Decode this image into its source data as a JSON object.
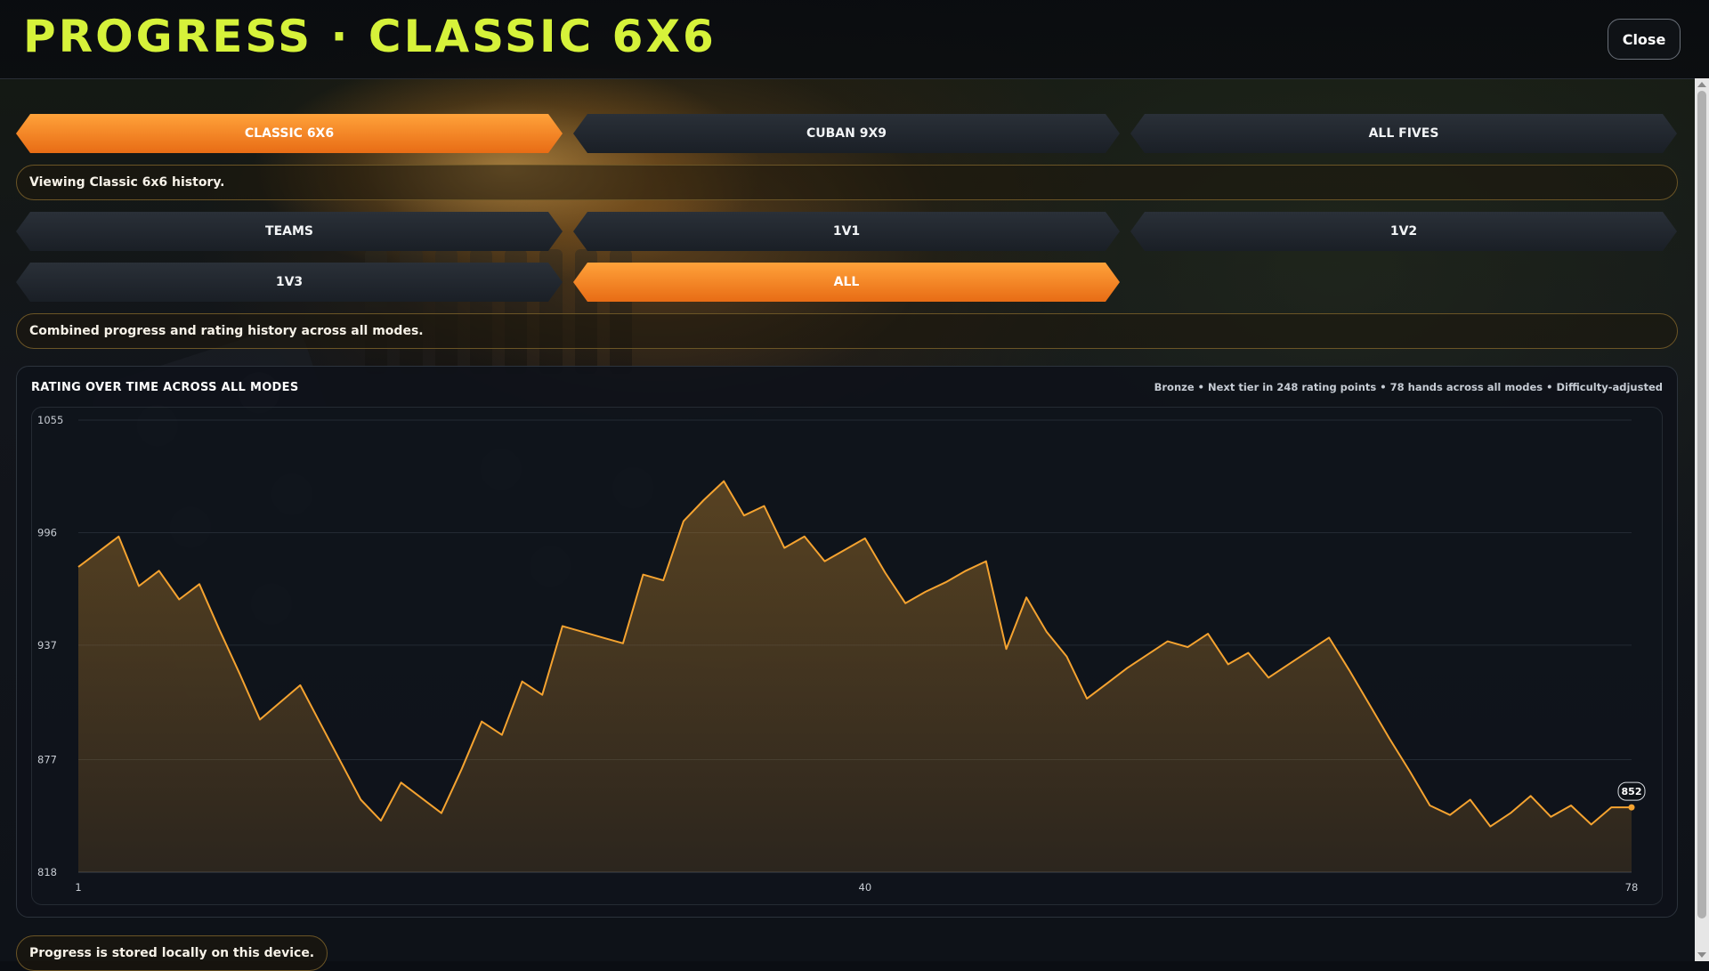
{
  "header": {
    "title": "PROGRESS · CLASSIC 6X6",
    "close_label": "Close"
  },
  "game_tabs": [
    {
      "label": "CLASSIC 6X6",
      "active": true
    },
    {
      "label": "CUBAN 9X9",
      "active": false
    },
    {
      "label": "ALL FIVES",
      "active": false
    }
  ],
  "game_info": "Viewing Classic 6x6 history.",
  "mode_tabs": [
    {
      "label": "TEAMS",
      "active": false
    },
    {
      "label": "1V1",
      "active": false
    },
    {
      "label": "1V2",
      "active": false
    },
    {
      "label": "1V3",
      "active": false
    },
    {
      "label": "ALL",
      "active": true
    }
  ],
  "mode_info": "Combined progress and rating history across all modes.",
  "chart_panel": {
    "title": "RATING OVER TIME ACROSS ALL MODES",
    "meta": "Bronze • Next tier in 248 rating points • 78 hands across all modes • Difficulty-adjusted"
  },
  "footer_note": "Progress is stored locally on this device.",
  "colors": {
    "title": "#d6f23a",
    "accent": "#f59a2e",
    "line": "#f5a330"
  },
  "chart_data": {
    "type": "area",
    "title": "RATING OVER TIME ACROSS ALL MODES",
    "xlabel": "",
    "ylabel": "",
    "x_ticks": [
      1,
      40,
      78
    ],
    "y_ticks": [
      818,
      877,
      937,
      996,
      1055
    ],
    "xlim": [
      1,
      78
    ],
    "ylim": [
      818,
      1055
    ],
    "grid": true,
    "last_value_label": "852",
    "series": [
      {
        "x": [
          1,
          2,
          3,
          4,
          5,
          6,
          7,
          8,
          9,
          10,
          11,
          12,
          13,
          14,
          15,
          16,
          17,
          18,
          19,
          20,
          21,
          22,
          23,
          24,
          25,
          26,
          27,
          28,
          29,
          30,
          31,
          32,
          33,
          34,
          35,
          36,
          37,
          38,
          39,
          40,
          41,
          42,
          43,
          44,
          45,
          46,
          47,
          48,
          49,
          50,
          51,
          52,
          53,
          54,
          55,
          56,
          57,
          58,
          59,
          60,
          61,
          62,
          63,
          64,
          65,
          66,
          67,
          68,
          69,
          70,
          71,
          72,
          73,
          74,
          75,
          76,
          77,
          78
        ],
        "values": [
          978,
          986,
          994,
          968,
          976,
          961,
          969,
          945,
          922,
          898,
          907,
          916,
          896,
          876,
          856,
          845,
          865,
          857,
          849,
          872,
          897,
          890,
          918,
          911,
          947,
          944,
          941,
          938,
          974,
          971,
          1002,
          1013,
          1023,
          1005,
          1010,
          988,
          994,
          981,
          987,
          993,
          975,
          959,
          965,
          970,
          976,
          981,
          935,
          962,
          944,
          931,
          909,
          917,
          925,
          932,
          939,
          936,
          943,
          927,
          933,
          920,
          927,
          934,
          941,
          924,
          906,
          888,
          871,
          853,
          848,
          856,
          842,
          849,
          858,
          847,
          853,
          843,
          852,
          852
        ]
      }
    ]
  }
}
